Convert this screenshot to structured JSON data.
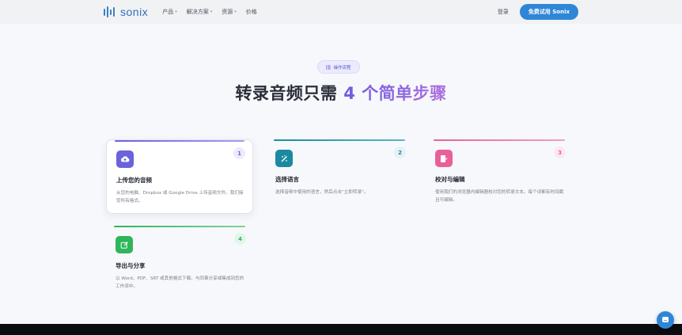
{
  "header": {
    "logo_text": "sonix",
    "nav": [
      {
        "label": "产品",
        "has_caret": true
      },
      {
        "label": "解决方案",
        "has_caret": true
      },
      {
        "label": "资源",
        "has_caret": true
      },
      {
        "label": "价格",
        "has_caret": false
      }
    ],
    "login_label": "登录",
    "cta_label": "免费试用 Sonix"
  },
  "hero": {
    "badge_label": "操作流程",
    "title_plain": "转录音频只需 ",
    "title_highlight": "4 个简单步骤"
  },
  "steps": [
    {
      "number": "1",
      "title": "上传您的音频",
      "description": "从您的电脑、Dropbox 或 Google Drive 上传音频文件。我们接受所有格式。",
      "icon": "cloud-upload-icon",
      "color": "#6b62dc",
      "active": true
    },
    {
      "number": "2",
      "title": "选择语言",
      "description": "选择音频中使用的语言，然后点击“立即转录”。",
      "icon": "magic-wand-icon",
      "color": "#1b8aa1",
      "active": false
    },
    {
      "number": "3",
      "title": "校对与编辑",
      "description": "使用我们的浏览器内编辑器校对您的转录文本。每个词都有时间戳且可编辑。",
      "icon": "edit-document-icon",
      "color": "#e8609a",
      "active": false
    },
    {
      "number": "4",
      "title": "导出与分享",
      "description": "以 Word、PDF、SRT 或其他格式下载。与同事分享或集成到您的工作流中。",
      "icon": "export-icon",
      "color": "#2fb55a",
      "active": false
    }
  ],
  "colors": {
    "primary": "#2f86d6",
    "accent": "#6a5be0"
  }
}
